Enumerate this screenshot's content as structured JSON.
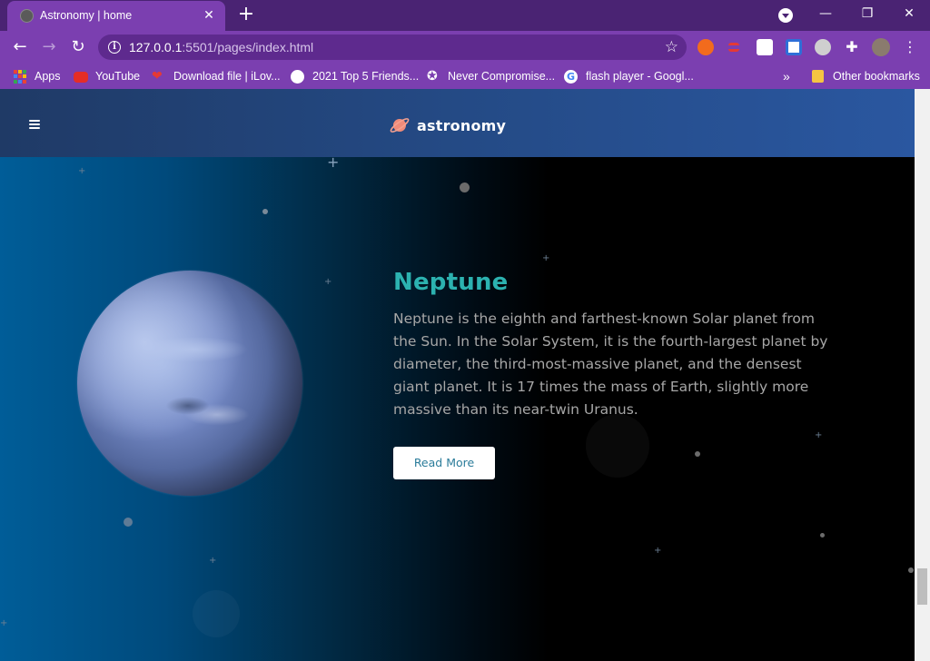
{
  "browser": {
    "tab_title": "Astronomy | home",
    "url_host": "127.0.0.1",
    "url_path": ":5501/pages/index.html",
    "bookmarks": [
      {
        "label": "Apps"
      },
      {
        "label": "YouTube"
      },
      {
        "label": "Download file | iLov..."
      },
      {
        "label": "2021 Top 5 Friends..."
      },
      {
        "label": "Never Compromise..."
      },
      {
        "label": "flash player - Googl..."
      }
    ],
    "other_bookmarks": "Other bookmarks",
    "overflow": "»",
    "colors": {
      "frame": "#4a2373",
      "toolbar": "#7b3fb0"
    }
  },
  "site": {
    "logo_text": "astronomy",
    "menu_icon": "hamburger-menu-icon"
  },
  "hero": {
    "title": "Neptune",
    "description": "Neptune is the eighth and farthest-known Solar planet from the Sun. In the Solar System, it is the fourth-largest planet by diameter, the third-most-massive planet, and the densest giant planet. It is 17 times the mass of Earth, slightly more massive than its near-twin Uranus.",
    "button": "Read More",
    "colors": {
      "title": "#2cb2b0",
      "text": "#a7a7a7",
      "button_text": "#2b7c9a"
    }
  }
}
